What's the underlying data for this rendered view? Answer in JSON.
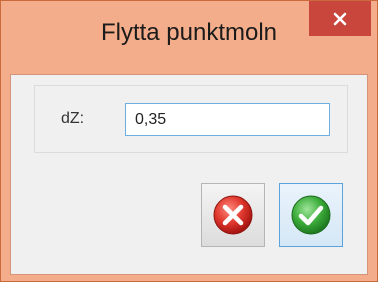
{
  "window": {
    "title": "Flytta punktmoln",
    "close_icon": "close-icon"
  },
  "form": {
    "dz_label": "dZ:",
    "dz_value": "0,35"
  },
  "buttons": {
    "cancel_icon": "cancel-x-icon",
    "ok_icon": "ok-check-icon"
  },
  "colors": {
    "title_bar": "#f4ad8a",
    "close_button": "#c8463b",
    "cancel_red": "#d6312a",
    "ok_green": "#3aa43c",
    "focus_border": "#6eaee3"
  }
}
